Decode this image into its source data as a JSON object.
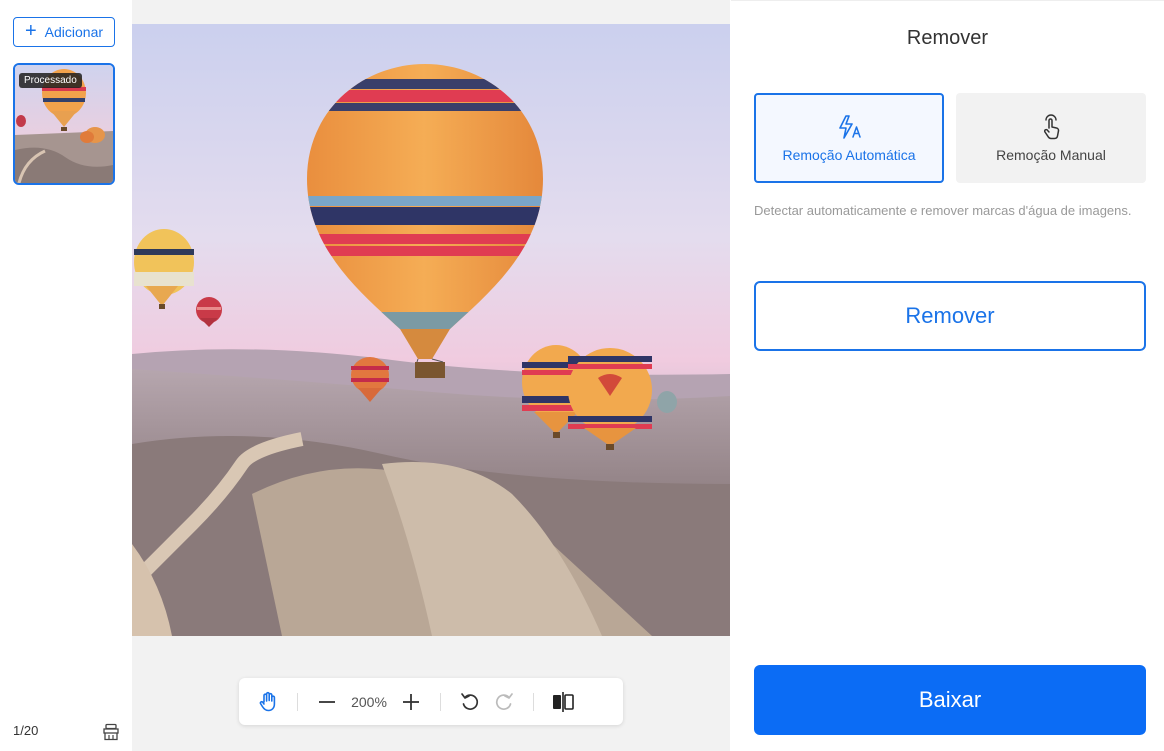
{
  "sidebar": {
    "add_label": "Adicionar",
    "thumb_badge": "Processado",
    "page_count": "1/20"
  },
  "toolbar": {
    "zoom": "200%"
  },
  "panel": {
    "title": "Remover",
    "mode_auto_label": "Remoção Automática",
    "mode_manual_label": "Remoção Manual",
    "description": "Detectar automaticamente e remover marcas d'água de imagens.",
    "remove_label": "Remover",
    "download_label": "Baixar"
  },
  "colors": {
    "accent": "#1a73e8",
    "download": "#0b6cf5"
  }
}
